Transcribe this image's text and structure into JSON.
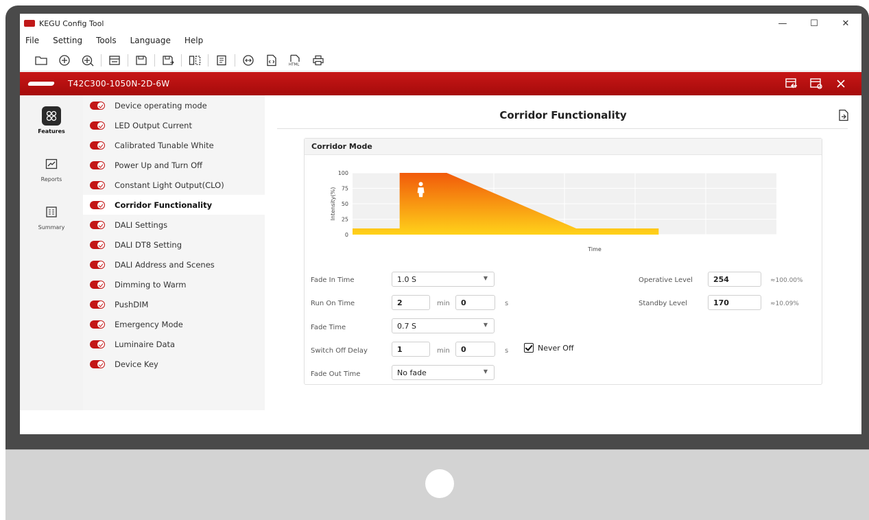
{
  "app": {
    "title": "KEGU Config Tool"
  },
  "window_controls": {
    "minimize": "—",
    "maximize": "☐",
    "close": "✕"
  },
  "menu": [
    "File",
    "Setting",
    "Tools",
    "Language",
    "Help"
  ],
  "toolbar_icons": [
    "open-folder-icon",
    "add-circle-icon",
    "add-device-icon",
    "read-device-icon",
    "save-icon",
    "save-as-icon",
    "compare-icon",
    "report-icon",
    "scan-icon",
    "export-code-icon",
    "export-html-icon",
    "print-icon"
  ],
  "device": {
    "name": "T42C300-1050N-2D-6W"
  },
  "nav": {
    "features": "Features",
    "reports": "Reports",
    "summary": "Summary"
  },
  "features": [
    "Device operating mode",
    "LED Output Current",
    "Calibrated Tunable White",
    "Power Up and Turn Off",
    "Constant Light Output(CLO)",
    "Corridor Functionality",
    "DALI Settings",
    "DALI DT8 Setting",
    "DALI Address and Scenes",
    "Dimming to Warm",
    "PushDIM",
    "Emergency Mode",
    "Luminaire Data",
    "Device Key"
  ],
  "selected_feature_index": 5,
  "page": {
    "title": "Corridor Functionality",
    "panel_title": "Corridor Mode"
  },
  "chart_data": {
    "type": "area",
    "ylabel": "Intensity(%)",
    "xlabel": "Time",
    "yticks": [
      100,
      75,
      50,
      25,
      0
    ],
    "ylim": [
      0,
      100
    ],
    "grid": true,
    "profile": [
      {
        "t": 0,
        "level": 10
      },
      {
        "t": 1.0,
        "level": 10
      },
      {
        "t": 1.0,
        "level": 100
      },
      {
        "t": 2.0,
        "level": 100
      },
      {
        "t": 4.75,
        "level": 10
      },
      {
        "t": 6.5,
        "level": 10
      }
    ],
    "xlim": [
      0,
      9
    ],
    "annotation_icon": "person-icon",
    "colors": {
      "top": "#f15a0a",
      "bottom": "#ffd21a"
    }
  },
  "form": {
    "fade_in_time": {
      "label": "Fade In Time",
      "value": "1.0 S"
    },
    "run_on_time": {
      "label": "Run On Time",
      "min": "2",
      "min_unit": "min",
      "sec": "0",
      "sec_unit": "s"
    },
    "fade_time": {
      "label": "Fade Time",
      "value": "0.7 S"
    },
    "switch_off_delay": {
      "label": "Switch Off Delay",
      "min": "1",
      "min_unit": "min",
      "sec": "0",
      "sec_unit": "s",
      "never_off_label": "Never Off",
      "never_off_checked": true
    },
    "fade_out_time": {
      "label": "Fade Out Time",
      "value": "No fade"
    },
    "operative_level": {
      "label": "Operative Level",
      "value": "254",
      "percent": "≈100.00%"
    },
    "standby_level": {
      "label": "Standby Level",
      "value": "170",
      "percent": "≈10.09%"
    }
  },
  "dropdown_arrow": "▼"
}
